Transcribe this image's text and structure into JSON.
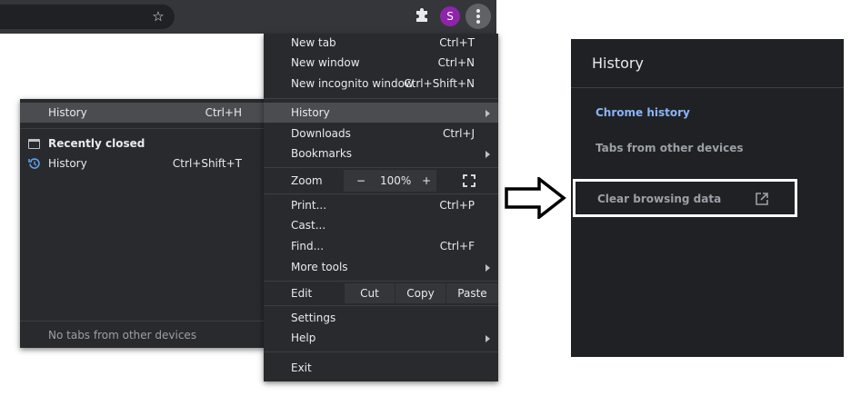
{
  "toolbar": {
    "avatar_letter": "S",
    "icons": [
      "star-icon",
      "puzzle-extension-icon",
      "kebab-menu-icon"
    ]
  },
  "menu": {
    "new_tab": {
      "label": "New tab",
      "shortcut": "Ctrl+T"
    },
    "new_window": {
      "label": "New window",
      "shortcut": "Ctrl+N"
    },
    "new_incognito": {
      "label": "New incognito window",
      "shortcut": "Ctrl+Shift+N"
    },
    "history": {
      "label": "History"
    },
    "downloads": {
      "label": "Downloads",
      "shortcut": "Ctrl+J"
    },
    "bookmarks": {
      "label": "Bookmarks"
    },
    "zoom": {
      "label": "Zoom",
      "minus": "−",
      "value": "100%",
      "plus": "+"
    },
    "print": {
      "label": "Print...",
      "shortcut": "Ctrl+P"
    },
    "cast": {
      "label": "Cast..."
    },
    "find": {
      "label": "Find...",
      "shortcut": "Ctrl+F"
    },
    "more_tools": {
      "label": "More tools"
    },
    "edit": {
      "label": "Edit",
      "cut": "Cut",
      "copy": "Copy",
      "paste": "Paste"
    },
    "settings": {
      "label": "Settings"
    },
    "help": {
      "label": "Help"
    },
    "exit": {
      "label": "Exit"
    }
  },
  "submenu": {
    "history": {
      "label": "History",
      "shortcut": "Ctrl+H"
    },
    "recently_closed": "Recently closed",
    "closed_history": {
      "label": "History",
      "shortcut": "Ctrl+Shift+T"
    },
    "no_tabs": "No tabs from other devices"
  },
  "panel": {
    "title": "History",
    "chrome_history": "Chrome history",
    "tabs_other_devices": "Tabs from other devices",
    "clear_browsing_data": "Clear browsing data"
  },
  "colors": {
    "menu_bg": "#292a2d",
    "highlight": "#4a4c50",
    "link_blue": "#8ab4f8",
    "avatar": "#8e24aa"
  }
}
